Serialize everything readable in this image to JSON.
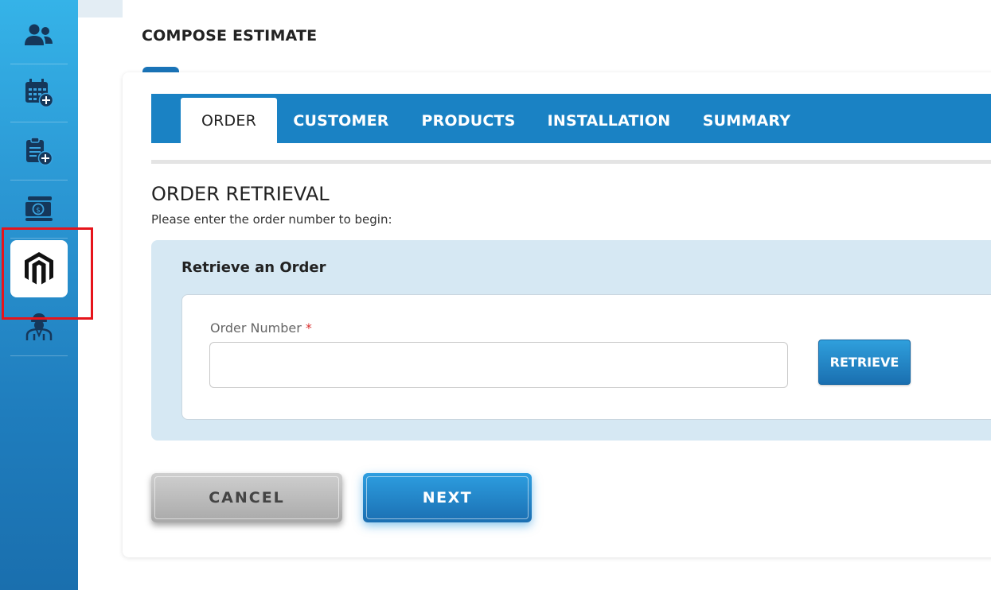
{
  "sidebar": {
    "items": [
      {
        "icon": "users-icon"
      },
      {
        "icon": "calendar-add-icon"
      },
      {
        "icon": "clipboard-add-icon"
      },
      {
        "icon": "money-icon"
      },
      {
        "icon": "magento-icon",
        "active": true
      },
      {
        "icon": "installer-icon"
      }
    ]
  },
  "header": {
    "title": "COMPOSE ESTIMATE"
  },
  "tabs": [
    {
      "label": "ORDER",
      "active": true
    },
    {
      "label": "CUSTOMER"
    },
    {
      "label": "PRODUCTS"
    },
    {
      "label": "INSTALLATION"
    },
    {
      "label": "SUMMARY"
    }
  ],
  "section": {
    "title": "ORDER RETRIEVAL",
    "subtitle": "Please enter the order number to begin:"
  },
  "retrieve": {
    "title": "Retrieve an Order",
    "field_label": "Order Number",
    "required_mark": "*",
    "input_value": "",
    "button_label": "RETRIEVE"
  },
  "actions": {
    "cancel_label": "CANCEL",
    "next_label": "NEXT"
  },
  "colors": {
    "accent": "#1a82c4",
    "panel_bg": "#d6e8f3",
    "highlight": "#e6141b"
  }
}
